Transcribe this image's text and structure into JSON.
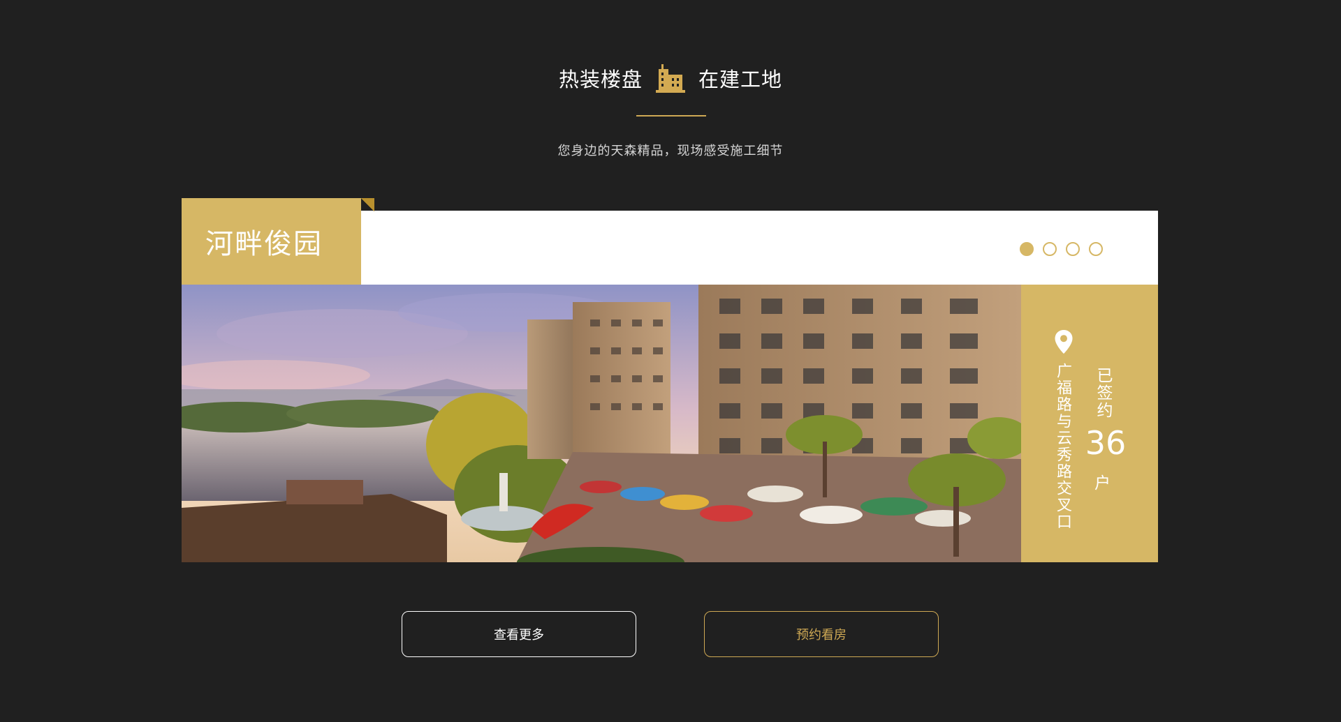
{
  "header": {
    "tab_left": "热装楼盘",
    "tab_right": "在建工地",
    "tab_icon": "building-icon",
    "subtitle": "您身边的天森精品，现场感受施工细节"
  },
  "project": {
    "name": "河畔俊园",
    "address": "广福路与云秀路交叉口",
    "signed_label": "已签约",
    "signed_count": "36",
    "signed_unit": "户",
    "location_icon": "map-pin-icon"
  },
  "carousel": {
    "slide_count": 4,
    "active_index": 0
  },
  "buttons": {
    "more": "查看更多",
    "book": "预约看房"
  },
  "colors": {
    "background": "#202020",
    "accent_gold": "#d6b765",
    "white": "#ffffff"
  }
}
